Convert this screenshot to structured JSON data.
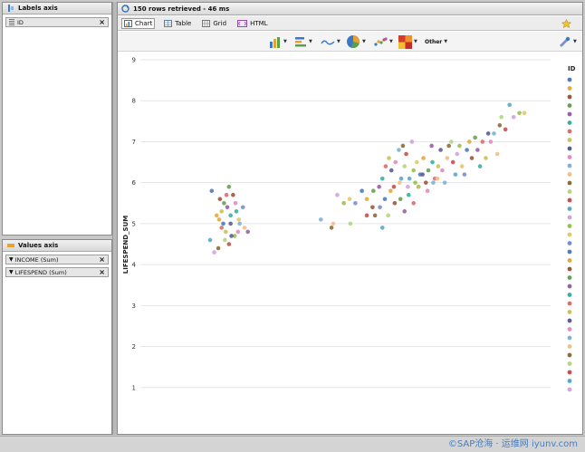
{
  "labels_axis": {
    "title": "Labels axis",
    "chips": [
      {
        "label": "ID"
      }
    ]
  },
  "values_axis": {
    "title": "Values axis",
    "chips": [
      {
        "label": "INCOME (Sum)"
      },
      {
        "label": "LIFESPEND (Sum)"
      }
    ]
  },
  "status_text": "150 rows retrieved - 46 ms",
  "tabs": [
    {
      "label": "Chart",
      "active": true
    },
    {
      "label": "Table"
    },
    {
      "label": "Grid"
    },
    {
      "label": "HTML"
    }
  ],
  "toolbar": {
    "other_label": "Other"
  },
  "remove_glyph": "×",
  "watermark": "©SAP沧海 · 运维网 iyunv.com",
  "chart_data": {
    "type": "scatter",
    "ylabel": "LIFESPEND_SUM",
    "xlabel": "",
    "ylim": [
      0,
      9
    ],
    "yticks": [
      1,
      2,
      3,
      4,
      5,
      6,
      7,
      8,
      9
    ],
    "grid": true,
    "legend_title": "ID",
    "legend_position": "right",
    "colors": [
      "#4f7cba",
      "#e9a73c",
      "#a1553a",
      "#6a9f58",
      "#9a5fa8",
      "#3bb0a0",
      "#d96f6f",
      "#c7c45a",
      "#5c5c9c",
      "#e58ac4",
      "#7fb3d5",
      "#f0c08a",
      "#8c6d3b",
      "#b5d67f",
      "#c94f4f",
      "#5aa8c7",
      "#d2a3e0",
      "#9bbf4d",
      "#e2c96a",
      "#7a8fd0"
    ],
    "points": [
      [
        87,
        5.8
      ],
      [
        93,
        5.2
      ],
      [
        97,
        5.6
      ],
      [
        102,
        5.5
      ],
      [
        106,
        5.4
      ],
      [
        110,
        5.2
      ],
      [
        99,
        4.9
      ],
      [
        104,
        4.8
      ],
      [
        110,
        5.0
      ],
      [
        116,
        5.5
      ],
      [
        121,
        5.0
      ],
      [
        127,
        4.9
      ],
      [
        95,
        4.4
      ],
      [
        103,
        4.6
      ],
      [
        108,
        4.5
      ],
      [
        85,
        4.6
      ],
      [
        90,
        4.3
      ],
      [
        115,
        4.7
      ],
      [
        120,
        5.1
      ],
      [
        125,
        5.4
      ],
      [
        101,
        5.0
      ],
      [
        96,
        5.1
      ],
      [
        113,
        5.7
      ],
      [
        108,
        5.9
      ],
      [
        131,
        4.8
      ],
      [
        117,
        5.3
      ],
      [
        105,
        5.7
      ],
      [
        99,
        5.3
      ],
      [
        111,
        4.7
      ],
      [
        119,
        4.8
      ],
      [
        220,
        5.1
      ],
      [
        235,
        5.0
      ],
      [
        233,
        4.9
      ],
      [
        256,
        5.0
      ],
      [
        276,
        5.2
      ],
      [
        295,
        4.9
      ],
      [
        240,
        5.7
      ],
      [
        248,
        5.5
      ],
      [
        255,
        5.6
      ],
      [
        262,
        5.5
      ],
      [
        270,
        5.8
      ],
      [
        276,
        5.6
      ],
      [
        283,
        5.4
      ],
      [
        284,
        5.8
      ],
      [
        291,
        5.9
      ],
      [
        295,
        6.1
      ],
      [
        299,
        6.4
      ],
      [
        303,
        6.6
      ],
      [
        306,
        6.3
      ],
      [
        311,
        6.5
      ],
      [
        315,
        6.8
      ],
      [
        316,
        6.0
      ],
      [
        320,
        6.9
      ],
      [
        322,
        6.4
      ],
      [
        324,
        6.7
      ],
      [
        328,
        6.1
      ],
      [
        331,
        7.0
      ],
      [
        333,
        6.3
      ],
      [
        337,
        6.5
      ],
      [
        339,
        5.9
      ],
      [
        341,
        6.2
      ],
      [
        345,
        6.6
      ],
      [
        348,
        6.0
      ],
      [
        351,
        6.3
      ],
      [
        355,
        6.9
      ],
      [
        356,
        6.5
      ],
      [
        359,
        6.1
      ],
      [
        363,
        6.4
      ],
      [
        366,
        6.8
      ],
      [
        368,
        6.3
      ],
      [
        371,
        6.0
      ],
      [
        374,
        6.6
      ],
      [
        376,
        6.9
      ],
      [
        379,
        7.0
      ],
      [
        381,
        6.5
      ],
      [
        384,
        6.2
      ],
      [
        386,
        6.7
      ],
      [
        389,
        6.9
      ],
      [
        392,
        6.4
      ],
      [
        395,
        6.2
      ],
      [
        398,
        6.8
      ],
      [
        401,
        7.0
      ],
      [
        404,
        6.6
      ],
      [
        408,
        7.1
      ],
      [
        411,
        6.8
      ],
      [
        414,
        6.4
      ],
      [
        417,
        7.0
      ],
      [
        421,
        6.6
      ],
      [
        424,
        7.2
      ],
      [
        427,
        7.0
      ],
      [
        431,
        7.2
      ],
      [
        435,
        6.7
      ],
      [
        438,
        7.4
      ],
      [
        440,
        7.6
      ],
      [
        445,
        7.3
      ],
      [
        450,
        7.9
      ],
      [
        455,
        7.6
      ],
      [
        462,
        7.7
      ],
      [
        468,
        7.7
      ],
      [
        292,
        5.4
      ],
      [
        298,
        5.6
      ],
      [
        305,
        5.8
      ],
      [
        310,
        5.5
      ],
      [
        317,
        5.6
      ],
      [
        322,
        5.3
      ],
      [
        327,
        5.7
      ],
      [
        333,
        5.5
      ],
      [
        339,
        5.9
      ],
      [
        344,
        6.2
      ],
      [
        350,
        5.8
      ],
      [
        357,
        6.0
      ],
      [
        362,
        6.1
      ],
      [
        286,
        5.2
      ],
      [
        302,
        5.2
      ],
      [
        309,
        5.9
      ],
      [
        318,
        6.1
      ],
      [
        326,
        5.9
      ],
      [
        335,
        6.0
      ]
    ]
  }
}
